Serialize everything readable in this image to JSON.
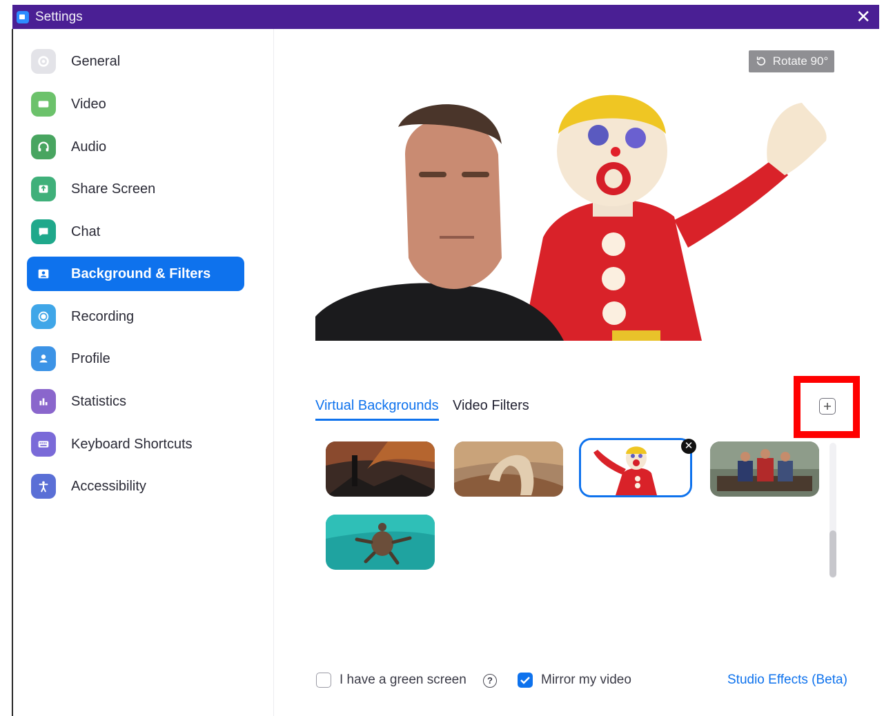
{
  "window": {
    "title": "Settings"
  },
  "sidebar": {
    "items": [
      {
        "label": "General",
        "icon": "gear-icon",
        "color": "#b5b5bd"
      },
      {
        "label": "Video",
        "icon": "video-camera-icon",
        "color": "#6cc26b"
      },
      {
        "label": "Audio",
        "icon": "headphones-icon",
        "color": "#48a560"
      },
      {
        "label": "Share Screen",
        "icon": "share-screen-icon",
        "color": "#3fb07a"
      },
      {
        "label": "Chat",
        "icon": "chat-bubble-icon",
        "color": "#1fa88b"
      },
      {
        "label": "Background & Filters",
        "icon": "background-icon",
        "color": "#0e72ed",
        "active": true
      },
      {
        "label": "Recording",
        "icon": "record-icon",
        "color": "#3fa6e8"
      },
      {
        "label": "Profile",
        "icon": "profile-icon",
        "color": "#3c93e6"
      },
      {
        "label": "Statistics",
        "icon": "statistics-icon",
        "color": "#8a66cc"
      },
      {
        "label": "Keyboard Shortcuts",
        "icon": "keyboard-icon",
        "color": "#7a6ad8"
      },
      {
        "label": "Accessibility",
        "icon": "accessibility-icon",
        "color": "#5a6fd6"
      }
    ]
  },
  "main": {
    "rotate_label": "Rotate 90°",
    "tabs": [
      {
        "label": "Virtual Backgrounds",
        "active": true
      },
      {
        "label": "Video Filters",
        "active": false
      }
    ],
    "backgrounds": [
      {
        "theme": "volcano-tower",
        "selected": false
      },
      {
        "theme": "desert-sandworm",
        "selected": false
      },
      {
        "theme": "clay-figure",
        "selected": true
      },
      {
        "theme": "three-people-couch",
        "selected": false
      },
      {
        "theme": "sea-turtle",
        "selected": false
      }
    ],
    "footer": {
      "green_screen_label": "I have a green screen",
      "green_screen_checked": false,
      "mirror_label": "Mirror my video",
      "mirror_checked": true,
      "studio_effects_label": "Studio Effects (Beta)"
    }
  },
  "colors": {
    "titlebar": "#4a1f94",
    "accent": "#0e72ed",
    "highlight": "#ff0000"
  }
}
